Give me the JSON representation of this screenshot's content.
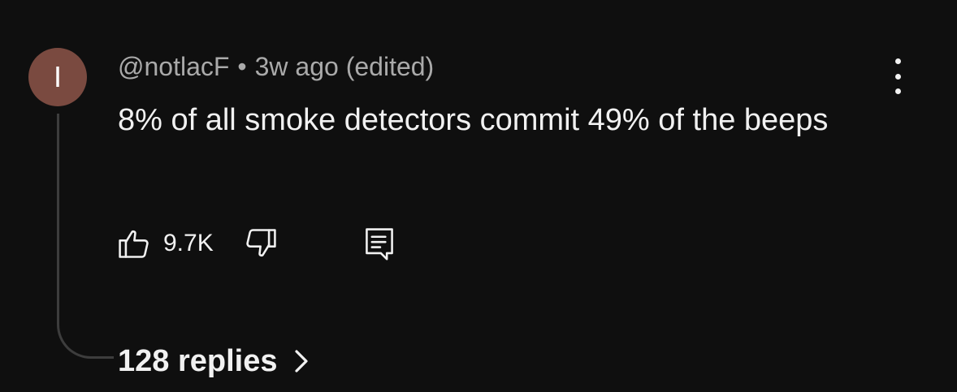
{
  "comment": {
    "avatar_initial": "I",
    "avatar_color": "#7a4a40",
    "author": "@notlacF",
    "separator": "•",
    "timestamp": "3w ago (edited)",
    "text": "8% of all smoke detectors commit 49% of the beeps",
    "like_count": "9.7K",
    "replies_label": "128 replies",
    "icons": {
      "like": "thumbs-up-icon",
      "dislike": "thumbs-down-icon",
      "reply": "reply-icon",
      "menu": "more-vertical-icon",
      "chevron": "chevron-right-icon"
    }
  }
}
